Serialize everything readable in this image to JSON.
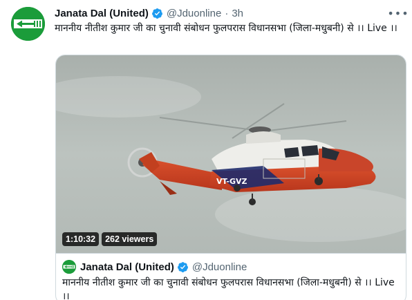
{
  "tweet": {
    "author_name": "Janata Dal (United)",
    "handle": "@Jduonline",
    "separator": "·",
    "time": "3h",
    "more_glyph": "•••",
    "text": "माननीय नीतीश कुमार जी का चुनावी संबोधन फुलपरास विधानसभा (जिला-मधुबनी) से ।। Live ।।"
  },
  "media": {
    "duration": "1:10:32",
    "viewers": "262 viewers",
    "helicopter_registration": "VT-GVZ"
  },
  "quoted": {
    "author_name": "Janata Dal (United)",
    "handle": "@Jduonline",
    "text": "माननीय नीतीश कुमार जी का चुनावी संबोधन फुलपरास विधानसभा (जिला-मधुबनी) से ।। Live ।।"
  },
  "colors": {
    "brand_green": "#1b9c3a",
    "verified_blue": "#1d9bf0",
    "sky": "#b6bdb8"
  }
}
